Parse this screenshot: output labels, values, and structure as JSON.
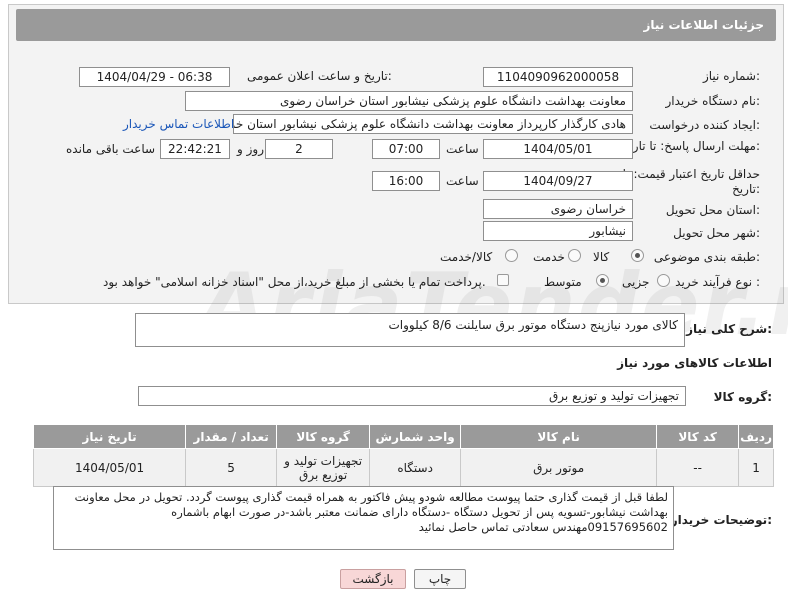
{
  "header": {
    "title": "جزئیات اطلاعات نیاز"
  },
  "fields": {
    "need_number_label": "شماره نیاز:",
    "need_number": "1104090962000058",
    "announce_label": "تاریخ و ساعت اعلان عمومی:",
    "announce_value": "1404/04/29 - 06:38",
    "buyer_org_label": "نام دستگاه خریدار:",
    "buyer_org": "معاونت بهداشت دانشگاه علوم پزشکی نیشابور استان خراسان رضوی",
    "requester_label": "ایجاد کننده درخواست:",
    "requester": "هادی کارگذار کارپرداز معاونت بهداشت دانشگاه علوم پزشکی نیشابور استان خر",
    "buyer_contact_link": "اطلاعات تماس خریدار",
    "deadline_label": "مهلت ارسال پاسخ: تا تاریخ:",
    "deadline_date": "1404/05/01",
    "time_label": "ساعت",
    "deadline_time": "07:00",
    "days_value": "2",
    "days_label": "روز و",
    "remaining_time": "22:42:21",
    "remaining_label": "ساعت باقی مانده",
    "validity_label": "حداقل تاریخ اعتبار قیمت: تا تاریخ:",
    "validity_date": "1404/09/27",
    "validity_time": "16:00",
    "province_label": "استان محل تحویل:",
    "province": "خراسان رضوی",
    "city_label": "شهر محل تحویل:",
    "city": "نیشابور",
    "category_label": "طبقه بندی موضوعی:",
    "category_options": [
      "کالا",
      "خدمت",
      "کالا/خدمت"
    ],
    "process_label": "نوع فرآیند خرید :",
    "process_options": [
      "جزیی",
      "متوسط"
    ],
    "payment_note": "پرداخت تمام یا بخشی از مبلغ خرید،از محل \"اسناد خزانه اسلامی\" خواهد بود."
  },
  "description": {
    "label": "شرح کلی نیاز:",
    "text": "کالای مورد نیازپنج دستگاه موتور برق سایلنت 8/6 کیلووات"
  },
  "goods_section": {
    "title": "اطلاعات کالاهای مورد نیاز",
    "group_label": "گروه کالا:",
    "group_value": "تجهیزات تولید و توزیع برق"
  },
  "table": {
    "headers": [
      "ردیف",
      "کد کالا",
      "نام کالا",
      "واحد شمارش",
      "گروه کالا",
      "تعداد / مقدار",
      "تاریخ نیاز"
    ],
    "rows": [
      [
        "1",
        "--",
        "موتور برق",
        "دستگاه",
        "تجهیزات تولید و توزیع برق",
        "5",
        "1404/05/01"
      ]
    ]
  },
  "buyer_notes": {
    "label": "توضیحات خریدار:",
    "text": "لطفا قبل از قیمت گذاری حتما پیوست مطالعه شودو پیش فاکتور به همراه قیمت گذاری پیوست گردد. تحویل در محل معاونت بهداشت نیشابور-تسویه پس از تحویل دستگاه -دستگاه دارای ضمانت معتبر باشد-در صورت ابهام باشماره 09157695602مهندس سعادتی تماس حاصل نمائید"
  },
  "buttons": {
    "print": "چاپ",
    "back": "بازگشت"
  },
  "watermark": "AriaTender.neT"
}
